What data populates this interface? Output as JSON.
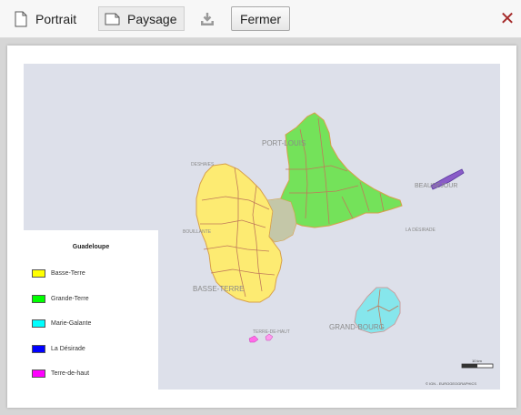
{
  "toolbar": {
    "portrait_label": "Portrait",
    "paysage_label": "Paysage",
    "fermer_label": "Fermer"
  },
  "map": {
    "labels": {
      "port_louis": "PORT-LOUIS",
      "basse_terre": "BASSE-TERRE",
      "grand_bourg": "GRAND-BOURG",
      "beausejour": "BEAUSÉJOUR",
      "deshaies": "DESHAIES",
      "bouillante": "BOUILLANTE",
      "la_desirade": "LA DÉSIRADE",
      "terre_de_haut": "TERRE-DE-HAUT"
    },
    "scale_label": "10 km",
    "copyright": "© IGN - EUROGEOGRAPHICS"
  },
  "legend": {
    "title": "Guadeloupe",
    "items": [
      {
        "label": "Basse-Terre",
        "color": "#ffff00"
      },
      {
        "label": "Grande-Terre",
        "color": "#00ff00"
      },
      {
        "label": "Marie-Galante",
        "color": "#00ffff"
      },
      {
        "label": "La Désirade",
        "color": "#0000ff"
      },
      {
        "label": "Terre-de-haut",
        "color": "#ff00ff"
      }
    ]
  },
  "colors": {
    "sea": "#dde0ea",
    "basse_terre_fill": "#fdeb72",
    "grande_terre_fill": "#74e25a",
    "marie_galante_fill": "#86e6ec",
    "la_desirade_fill": "#8a5cc8",
    "terre_de_haut_fill": "#ff6be8",
    "commune_border": "#c07a5a",
    "close_icon": "#a52a2a"
  }
}
